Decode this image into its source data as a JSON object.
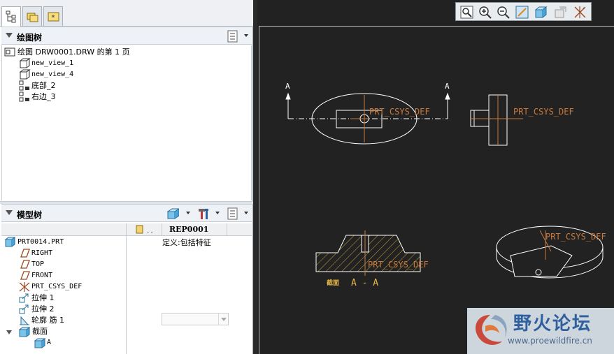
{
  "drawing_tree": {
    "title": "绘图树",
    "items": [
      {
        "icon": "drawing-sheet-icon",
        "label": "绘图 DRW0001.DRW 的第 1 页"
      },
      {
        "icon": "general-view-icon",
        "label": "new_view_1"
      },
      {
        "icon": "general-view-icon",
        "label": "new_view_4"
      },
      {
        "icon": "projection-view-icon",
        "label": "底部_2"
      },
      {
        "icon": "projection-view-icon",
        "label": "右边_3"
      }
    ]
  },
  "model_tree": {
    "title": "模型树",
    "column_header": "REP0001",
    "column_value": "定义:包括特征",
    "items": [
      {
        "icon": "part-icon",
        "label": "PRT0014.PRT"
      },
      {
        "icon": "datum-plane-icon",
        "label": "RIGHT"
      },
      {
        "icon": "datum-plane-icon",
        "label": "TOP"
      },
      {
        "icon": "datum-plane-icon",
        "label": "FRONT"
      },
      {
        "icon": "coordinate-system-icon",
        "label": "PRT_CSYS_DEF"
      },
      {
        "icon": "extrude-icon",
        "label": "拉伸 1"
      },
      {
        "icon": "extrude-icon",
        "label": "拉伸 2"
      },
      {
        "icon": "rib-icon",
        "label": "轮廓 筋 1"
      },
      {
        "icon": "section-folder-icon",
        "label": "截面"
      },
      {
        "icon": "section-icon",
        "label": "A"
      }
    ]
  },
  "drawing": {
    "cut_label_left": "A",
    "cut_label_right": "A",
    "csys_top": "PRT_CSYS_DEF",
    "csys_right": "PRT_CSYS_DEF",
    "csys_section": "PRT_CSYS_DEF",
    "csys_iso": "PRT_CSYS_DEF",
    "section_word": "截面",
    "section_name": "A - A"
  },
  "watermark": {
    "title": "野火论坛",
    "url": "www.proewildfire.cn"
  },
  "colors": {
    "background": "#222222",
    "geometry": "#ffffff",
    "csys": "#c8793c",
    "section_label": "#e8b84a"
  }
}
